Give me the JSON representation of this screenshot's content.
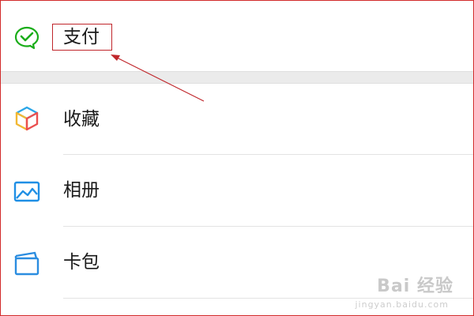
{
  "menu": {
    "items": [
      {
        "label": "支付",
        "icon": "wechat-pay-icon"
      },
      {
        "label": "收藏",
        "icon": "favorites-cube-icon"
      },
      {
        "label": "相册",
        "icon": "album-picture-icon"
      },
      {
        "label": "卡包",
        "icon": "card-wallet-icon"
      }
    ]
  },
  "annotation": {
    "highlight_target": "支付"
  },
  "watermark": {
    "text": "Bai 经验",
    "sub": "jingyan.baidu.com"
  },
  "colors": {
    "annotation_red": "#c0262b",
    "wechat_green": "#1aad19",
    "album_blue": "#1f8fe5",
    "card_blue": "#2b8de0"
  }
}
